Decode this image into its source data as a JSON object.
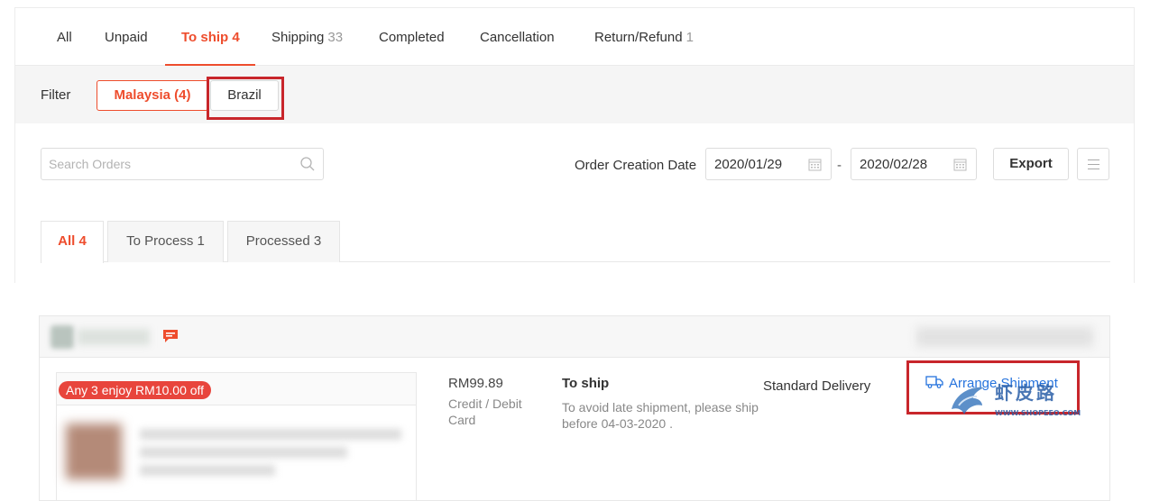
{
  "status_tabs": [
    {
      "label": "All",
      "count": ""
    },
    {
      "label": "Unpaid",
      "count": ""
    },
    {
      "label": "To ship 4",
      "count": ""
    },
    {
      "label": "Shipping",
      "count": "33"
    },
    {
      "label": "Completed",
      "count": ""
    },
    {
      "label": "Cancellation",
      "count": ""
    },
    {
      "label": "Return/Refund",
      "count": "1"
    }
  ],
  "active_status_tab": "To ship 4",
  "filter": {
    "label": "Filter",
    "options": [
      {
        "label": "Malaysia (4)",
        "selected": true
      },
      {
        "label": "Brazil",
        "selected": false
      }
    ]
  },
  "search": {
    "placeholder": "Search Orders",
    "value": ""
  },
  "date_filter": {
    "label": "Order Creation Date",
    "start": "2020/01/29",
    "separator": "-",
    "end": "2020/02/28"
  },
  "export_label": "Export",
  "sub_tabs": [
    {
      "label": "All 4",
      "active": true
    },
    {
      "label": "To Process 1",
      "active": false
    },
    {
      "label": "Processed 3",
      "active": false
    }
  ],
  "order": {
    "promo": "Any 3 enjoy RM10.00 off",
    "price": "RM99.89",
    "payment_method": "Credit / Debit Card",
    "status": "To ship",
    "status_note": "To avoid late shipment, please ship before 04-03-2020 .",
    "delivery": "Standard Delivery",
    "action": "Arrange Shipment"
  },
  "watermark": {
    "text": "虾皮路",
    "url": "WWW.SHOPEEO.COM"
  },
  "colors": {
    "accent": "#ee4d2d",
    "link": "#2673dd",
    "highlight_box": "#c8262b",
    "promo": "#e8453c"
  },
  "icons": [
    "search-icon",
    "calendar-icon",
    "menu-lines-icon",
    "chat-icon",
    "truck-icon"
  ]
}
